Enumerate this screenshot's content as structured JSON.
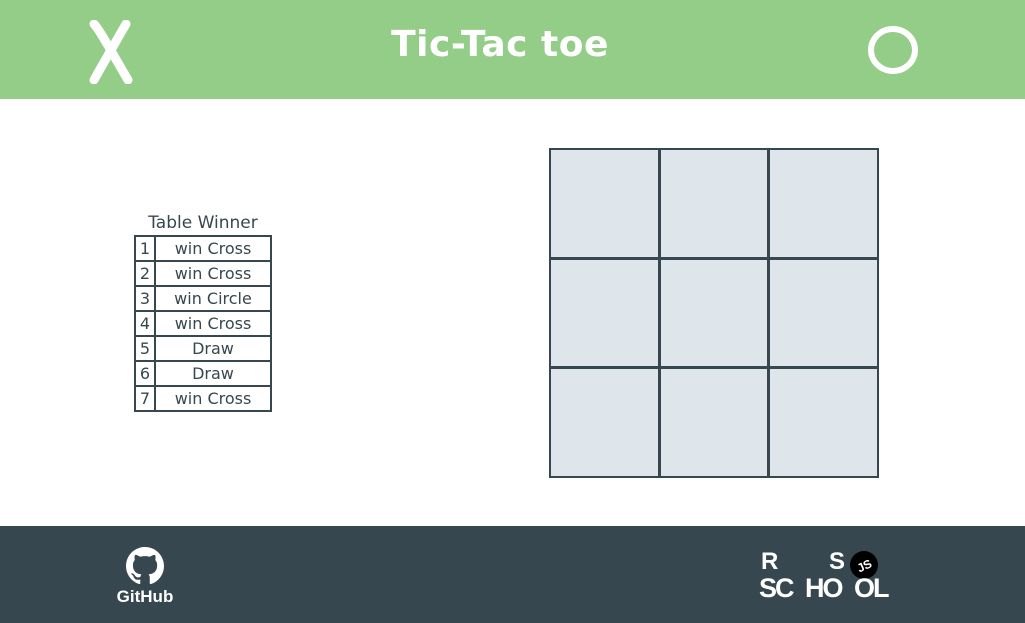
{
  "header": {
    "title": "Tic-Tac toe",
    "cross_icon": "cross-mark-icon",
    "circle_icon": "circle-mark-icon"
  },
  "winner_table": {
    "caption": "Table Winner",
    "rows": [
      {
        "num": "1",
        "result": "win Cross"
      },
      {
        "num": "2",
        "result": "win Cross"
      },
      {
        "num": "3",
        "result": "win Circle"
      },
      {
        "num": "4",
        "result": "win Cross"
      },
      {
        "num": "5",
        "result": "Draw"
      },
      {
        "num": "6",
        "result": "Draw"
      },
      {
        "num": "7",
        "result": "win Cross"
      }
    ]
  },
  "board": {
    "cells": [
      "",
      "",
      "",
      "",
      "",
      "",
      "",
      "",
      ""
    ]
  },
  "footer": {
    "github_label": "GitHub",
    "rs_logo": {
      "line1_left": "R",
      "line1_right": "S",
      "line2_a": "SC",
      "line2_b": "HO",
      "line2_c": "OL",
      "badge": "JS"
    }
  },
  "colors": {
    "header_bg": "#93cd88",
    "footer_bg": "#37474f",
    "cell_bg": "#dfe6eb",
    "grid_line": "#37474f",
    "text": "#37474f"
  }
}
